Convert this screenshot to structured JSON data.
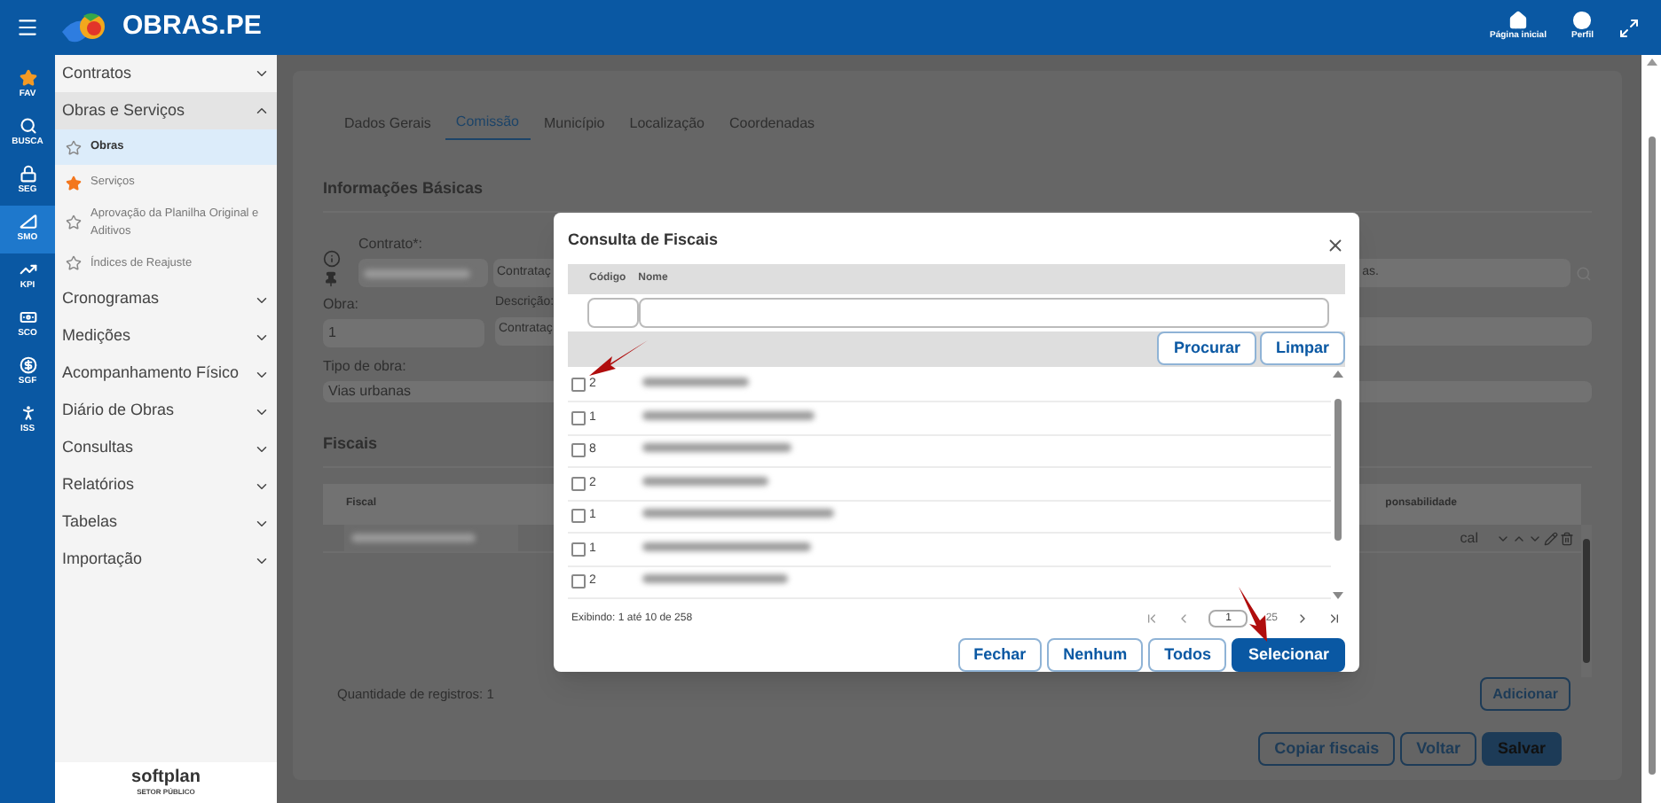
{
  "header": {
    "title": "OBRAS.PE",
    "actions": [
      {
        "kind": "home",
        "label": "Página inicial"
      },
      {
        "kind": "profile",
        "label": "Perfil"
      }
    ]
  },
  "rail": [
    {
      "kind": "fav",
      "label": "FAV",
      "selected": false
    },
    {
      "kind": "search",
      "label": "BUSCA",
      "selected": false
    },
    {
      "kind": "lock",
      "label": "SEG",
      "selected": false
    },
    {
      "kind": "ruler",
      "label": "SMO",
      "selected": true
    },
    {
      "kind": "chart",
      "label": "KPI",
      "selected": false
    },
    {
      "kind": "card",
      "label": "SCO",
      "selected": false
    },
    {
      "kind": "money",
      "label": "SGF",
      "selected": false
    },
    {
      "kind": "person",
      "label": "ISS",
      "selected": false
    }
  ],
  "sidebar": {
    "items": [
      {
        "label": "Contratos",
        "expanded": false
      },
      {
        "label": "Obras e Serviços",
        "expanded": true,
        "children": [
          {
            "label": "Obras",
            "selected": true,
            "starred": false
          },
          {
            "label": "Serviços",
            "selected": false,
            "starred": true
          },
          {
            "label": "Aprovação da Planilha Original e Aditivos",
            "selected": false,
            "starred": false
          },
          {
            "label": "Índices de Reajuste",
            "selected": false,
            "starred": false
          }
        ]
      },
      {
        "label": "Cronogramas",
        "expanded": false
      },
      {
        "label": "Medições",
        "expanded": false
      },
      {
        "label": "Acompanhamento Físico",
        "expanded": false
      },
      {
        "label": "Diário de Obras",
        "expanded": false
      },
      {
        "label": "Consultas",
        "expanded": false
      },
      {
        "label": "Relatórios",
        "expanded": false
      },
      {
        "label": "Tabelas",
        "expanded": false
      },
      {
        "label": "Importação",
        "expanded": false
      }
    ],
    "footer": {
      "brand": "softplan",
      "subtitle": "SETOR PÚBLICO"
    }
  },
  "page": {
    "tabs": [
      {
        "label": "Dados Gerais",
        "selected": false
      },
      {
        "label": "Comissão",
        "selected": true
      },
      {
        "label": "Município",
        "selected": false
      },
      {
        "label": "Localização",
        "selected": false
      },
      {
        "label": "Coordenadas",
        "selected": false
      }
    ],
    "section": "Informações Básicas",
    "contract_label": "Contrato*:",
    "contract_value": "Contrataç",
    "contract_tail": "as.",
    "obra_label": "Obra:",
    "obra_value": "1",
    "description_label": "Descrição:",
    "description_value": "Contrataç",
    "type_label": "Tipo de obra:",
    "type_value": "Vias urbanas",
    "fiscais": {
      "title": "Fiscais",
      "column_1": "Fiscal",
      "column_2": "ponsabilidade",
      "row_value": "cal",
      "count": "Quantidade de registros: 1",
      "add": "Adicionar"
    },
    "buttons": [
      {
        "label": "Copiar fiscais",
        "primary": false
      },
      {
        "label": "Voltar",
        "primary": false
      },
      {
        "label": "Salvar",
        "primary": true
      }
    ]
  },
  "dialog": {
    "title": "Consulta de Fiscais",
    "columns": [
      "Código",
      "Nome"
    ],
    "search_buttons": [
      "Procurar",
      "Limpar"
    ],
    "rows": [
      {
        "code": "2",
        "checked": false
      },
      {
        "code": "1",
        "checked": false
      },
      {
        "code": "8",
        "checked": false
      },
      {
        "code": "2",
        "checked": false
      },
      {
        "code": "1",
        "checked": false
      },
      {
        "code": "1",
        "checked": false
      },
      {
        "code": "2",
        "checked": false
      }
    ],
    "summary": "Exibindo: 1 até 10 de 258",
    "page": "1",
    "pages": "25",
    "buttons": [
      {
        "label": "Fechar",
        "primary": false
      },
      {
        "label": "Nenhum",
        "primary": false
      },
      {
        "label": "Todos",
        "primary": false
      },
      {
        "label": "Selecionar",
        "primary": true
      }
    ]
  }
}
